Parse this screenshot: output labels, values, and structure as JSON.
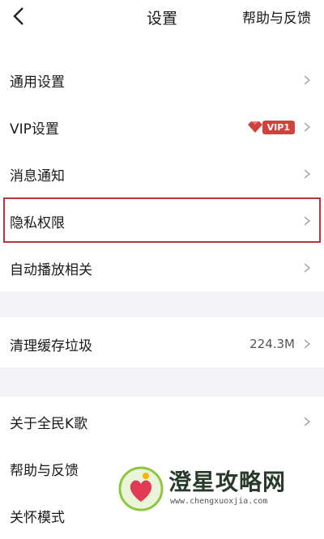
{
  "header": {
    "title": "设置",
    "help_label": "帮助与反馈"
  },
  "rows": [
    {
      "label": "通用设置"
    },
    {
      "label": "VIP设置",
      "badge": "VIP1"
    },
    {
      "label": "消息通知"
    },
    {
      "label": "隐私权限"
    },
    {
      "label": "自动播放相关"
    },
    {
      "label": "清理缓存垃圾",
      "value": "224.3M"
    },
    {
      "label": "关于全民K歌"
    },
    {
      "label": "帮助与反馈"
    },
    {
      "label": "关怀模式"
    }
  ],
  "watermark": {
    "title": "澄星攻略网",
    "url": "www.chengxuoxjia.com"
  },
  "colors": {
    "highlight": "#b23a3a",
    "vip_red": "#d0423d",
    "separator_bg": "#f4f4f6"
  }
}
